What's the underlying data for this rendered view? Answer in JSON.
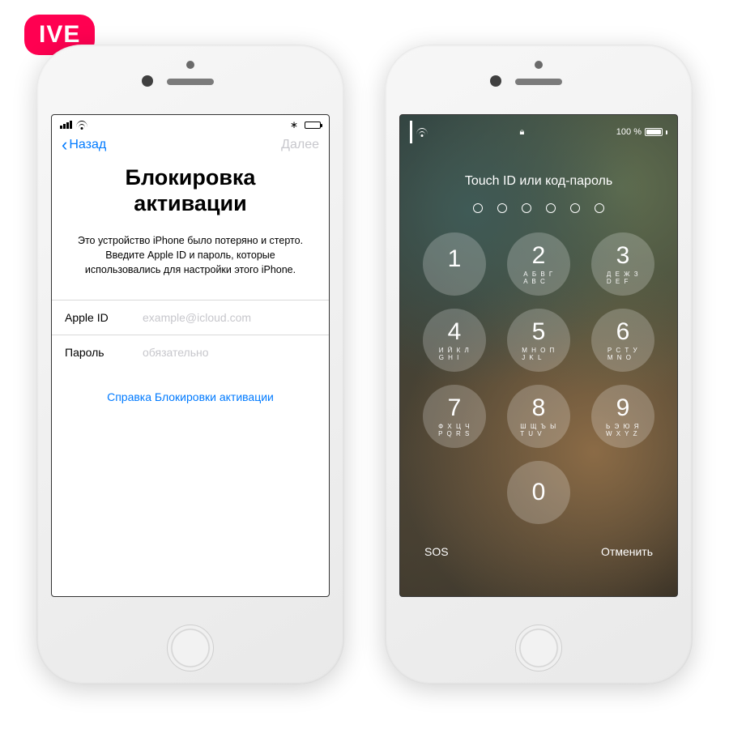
{
  "badge": "IVE",
  "left": {
    "status": {
      "bluetooth": "*"
    },
    "nav": {
      "back": "Назад",
      "next": "Далее"
    },
    "title": "Блокировка активации",
    "description": "Это устройство iPhone было потеряно и стерто. Введите Apple ID и пароль, которые использовались для настройки этого iPhone.",
    "fields": {
      "appleid_label": "Apple ID",
      "appleid_placeholder": "example@icloud.com",
      "password_label": "Пароль",
      "password_placeholder": "обязательно"
    },
    "help_link": "Справка Блокировки активации"
  },
  "right": {
    "status": {
      "battery_text": "100 %"
    },
    "title": "Touch ID или код-пароль",
    "passcode_length": 6,
    "keys": [
      {
        "n": "1",
        "s": " "
      },
      {
        "n": "2",
        "s": "А Б В Г\nA B C"
      },
      {
        "n": "3",
        "s": "Д Е Ж З\nD E F"
      },
      {
        "n": "4",
        "s": "И Й К Л\nG H I"
      },
      {
        "n": "5",
        "s": "М Н О П\nJ K L"
      },
      {
        "n": "6",
        "s": "Р С Т У\nM N O"
      },
      {
        "n": "7",
        "s": "Ф Х Ц Ч\nP Q R S"
      },
      {
        "n": "8",
        "s": "Ш Щ Ъ Ы\nT U V"
      },
      {
        "n": "9",
        "s": "Ь Э Ю Я\nW X Y Z"
      },
      {
        "n": "0",
        "s": ""
      }
    ],
    "bottom": {
      "sos": "SOS",
      "cancel": "Отменить"
    }
  }
}
